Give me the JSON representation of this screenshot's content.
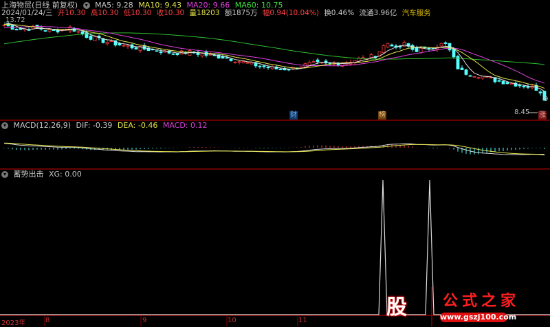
{
  "header": {
    "title": "上海物贸(日线 前复权)",
    "ma5": "MA5: 9.28",
    "ma10": "MA10: 9.43",
    "ma20": "MA20: 9.66",
    "ma60": "MA60: 10.75"
  },
  "quote": {
    "date": "2024/01/24/三",
    "open": "开10.30",
    "high": "高10.30",
    "low": "低10.30",
    "close": "收10.30",
    "volume": "量18203",
    "amount": "额1875万",
    "change": "幅0.94(10.04%)",
    "turnover": "换0.46%",
    "float": "流通3.96亿",
    "sector": "汽车服务"
  },
  "price_chart": {
    "max_label": "13.72",
    "min_label": "8.45",
    "right_label": "9",
    "tags": [
      {
        "text": "财",
        "color": "#3a7fd0"
      },
      {
        "text": "榜",
        "color": "#c08030"
      },
      {
        "text": "涨",
        "color": "#c03030"
      }
    ],
    "price_path": [
      [
        0,
        13.52
      ],
      [
        25,
        13.2
      ],
      [
        50,
        13.32
      ],
      [
        75,
        13.1
      ],
      [
        100,
        13.32
      ],
      [
        125,
        12.8
      ],
      [
        150,
        12.52
      ],
      [
        175,
        12.3
      ],
      [
        200,
        12.12
      ],
      [
        225,
        12.0
      ],
      [
        250,
        11.84
      ],
      [
        275,
        11.9
      ],
      [
        300,
        11.72
      ],
      [
        325,
        11.6
      ],
      [
        350,
        11.33
      ],
      [
        375,
        11.1
      ],
      [
        400,
        10.93
      ],
      [
        420,
        10.93
      ],
      [
        450,
        11.25
      ],
      [
        475,
        11.2
      ],
      [
        500,
        11.33
      ],
      [
        530,
        11.57
      ],
      [
        545,
        11.7
      ],
      [
        555,
        12.22
      ],
      [
        565,
        12.5
      ],
      [
        575,
        12.0
      ],
      [
        585,
        12.4
      ],
      [
        600,
        12.0
      ],
      [
        620,
        12.1
      ],
      [
        635,
        12.3
      ],
      [
        645,
        12.4
      ],
      [
        655,
        11.8
      ],
      [
        665,
        10.9
      ],
      [
        675,
        10.7
      ],
      [
        700,
        10.5
      ],
      [
        720,
        10.25
      ],
      [
        740,
        10.1
      ],
      [
        760,
        9.95
      ],
      [
        775,
        9.85
      ],
      [
        785,
        9.6
      ],
      [
        792,
        9.1
      ],
      [
        796,
        8.6
      ]
    ],
    "range": [
      8.2,
      13.9
    ]
  },
  "macd": {
    "label": "MACD(12,26,9)",
    "dif": "DIF: -0.39",
    "dea": "DEA: -0.46",
    "macd": "MACD: 0.12"
  },
  "indicator": {
    "label": "蓄势出击",
    "xg": "XG: 0.00",
    "signals": [
      557,
      625
    ]
  },
  "time_axis": [
    {
      "label": "2023年"
    },
    {
      "label": "8"
    },
    {
      "label": "9"
    },
    {
      "label": "10"
    },
    {
      "label": "11"
    }
  ],
  "watermark": {
    "logo": "股",
    "name": "公式之家",
    "url": "www.gszj100.com"
  },
  "colors": {
    "up": "#ff3c3c",
    "down": "#54ffff",
    "ma5": "#e0e0e0",
    "ma10": "#e6e64c",
    "ma20": "#e040e0",
    "ma60": "#30c030",
    "grid": "#8b0000"
  }
}
